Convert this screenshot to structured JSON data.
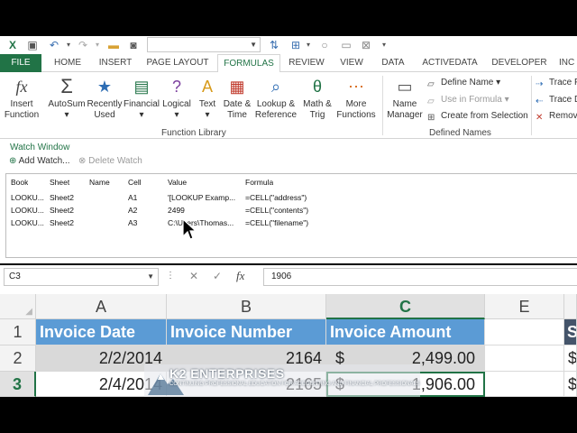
{
  "qat": {
    "namebox_value": ""
  },
  "ribbon_tabs": [
    "FILE",
    "HOME",
    "INSERT",
    "PAGE LAYOUT",
    "FORMULAS",
    "REVIEW",
    "VIEW",
    "DATA",
    "ACTIVEDATA",
    "DEVELOPER",
    "INC"
  ],
  "ribbon": {
    "insert_function": [
      "Insert",
      "Function"
    ],
    "autosum": "AutoSum",
    "recently_used": [
      "Recently",
      "Used"
    ],
    "financial": "Financial",
    "logical": "Logical",
    "text": "Text",
    "date_time": [
      "Date &",
      "Time"
    ],
    "lookup_reference": [
      "Lookup &",
      "Reference"
    ],
    "math_trig": [
      "Math &",
      "Trig"
    ],
    "more_functions": [
      "More",
      "Functions"
    ],
    "function_library_label": "Function Library",
    "name_manager": [
      "Name",
      "Manager"
    ],
    "define_name": "Define Name",
    "use_in_formula": "Use in Formula",
    "create_from_selection": "Create from Selection",
    "defined_names_label": "Defined Names",
    "trace_precedents": "Trace P",
    "trace_dependents": "Trace D",
    "remove_arrows": "Remov"
  },
  "watch_window": {
    "title": "Watch Window",
    "add_watch": "Add Watch...",
    "delete_watch": "Delete Watch",
    "columns": [
      "Book",
      "Sheet",
      "Name",
      "Cell",
      "Value",
      "Formula"
    ],
    "rows": [
      {
        "book": "LOOKU...",
        "sheet": "Sheet2",
        "name": "",
        "cell": "A1",
        "value": "'[LOOKUP Examp...",
        "formula": "=CELL(\"address\")"
      },
      {
        "book": "LOOKU...",
        "sheet": "Sheet2",
        "name": "",
        "cell": "A2",
        "value": "2499",
        "formula": "=CELL(\"contents\")"
      },
      {
        "book": "LOOKU...",
        "sheet": "Sheet2",
        "name": "",
        "cell": "A3",
        "value": "C:\\Users\\Thomas...",
        "formula": "=CELL(\"filename\")"
      }
    ]
  },
  "formula_bar": {
    "name_box": "C3",
    "dots": "⋮",
    "cancel": "✕",
    "enter": "✓",
    "fx": "fx",
    "content": "1906"
  },
  "sheet": {
    "col_headers": [
      "A",
      "B",
      "C",
      "E"
    ],
    "row_headers": [
      "1",
      "2",
      "3"
    ],
    "rows": [
      [
        "Invoice Date",
        "Invoice Number",
        "Invoice Amount",
        ""
      ],
      [
        "2/2/2014",
        "2164",
        "$",
        "2,499.00"
      ],
      [
        "2/4/2014",
        "2165",
        "$",
        "1,906.00"
      ]
    ],
    "right_clip": [
      "S",
      "$",
      "$"
    ]
  },
  "watermark": {
    "brand": "K2 ENTERPRISES",
    "tagline": "CONTINUING PROFESSIONAL EDUCATION FOR ACCOUNTING AND FINANCIAL PROFESSIONALS"
  },
  "colors": {
    "excel_green": "#217346",
    "header_blue": "#5b9bd5",
    "row_gray": "#d9d9d9"
  }
}
